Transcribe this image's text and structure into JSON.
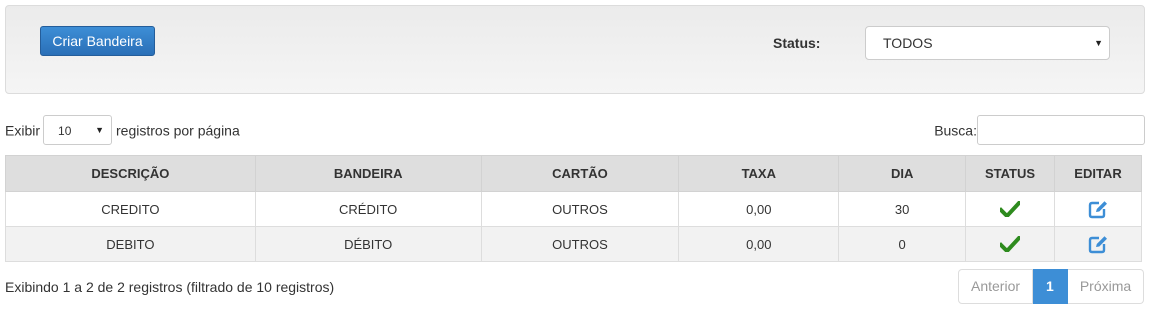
{
  "toolbar": {
    "create_label": "Criar Bandeira",
    "status_label": "Status:",
    "status_value": "TODOS"
  },
  "table_controls": {
    "show_prefix": "Exibir",
    "page_length": "10",
    "show_suffix": "registros por página",
    "search_label": "Busca:"
  },
  "table": {
    "headers": [
      "DESCRIÇÃO",
      "BANDEIRA",
      "CARTÃO",
      "TAXA",
      "DIA",
      "STATUS",
      "EDITAR"
    ],
    "rows": [
      {
        "descricao": "CREDITO",
        "bandeira": "CRÉDITO",
        "cartao": "OUTROS",
        "taxa": "0,00",
        "dia": "30",
        "status": "check-icon",
        "editar": "edit-icon"
      },
      {
        "descricao": "DEBITO",
        "bandeira": "DÉBITO",
        "cartao": "OUTROS",
        "taxa": "0,00",
        "dia": "0",
        "status": "check-icon",
        "editar": "edit-icon"
      }
    ]
  },
  "footer": {
    "info": "Exibindo 1 a 2 de 2 registros (filtrado de 10 registros)",
    "prev_label": "Anterior",
    "current_page": "1",
    "next_label": "Próxima"
  },
  "colors": {
    "accent": "#3d8ed6",
    "check": "#2e8b1e",
    "header_bg": "#dedede"
  }
}
